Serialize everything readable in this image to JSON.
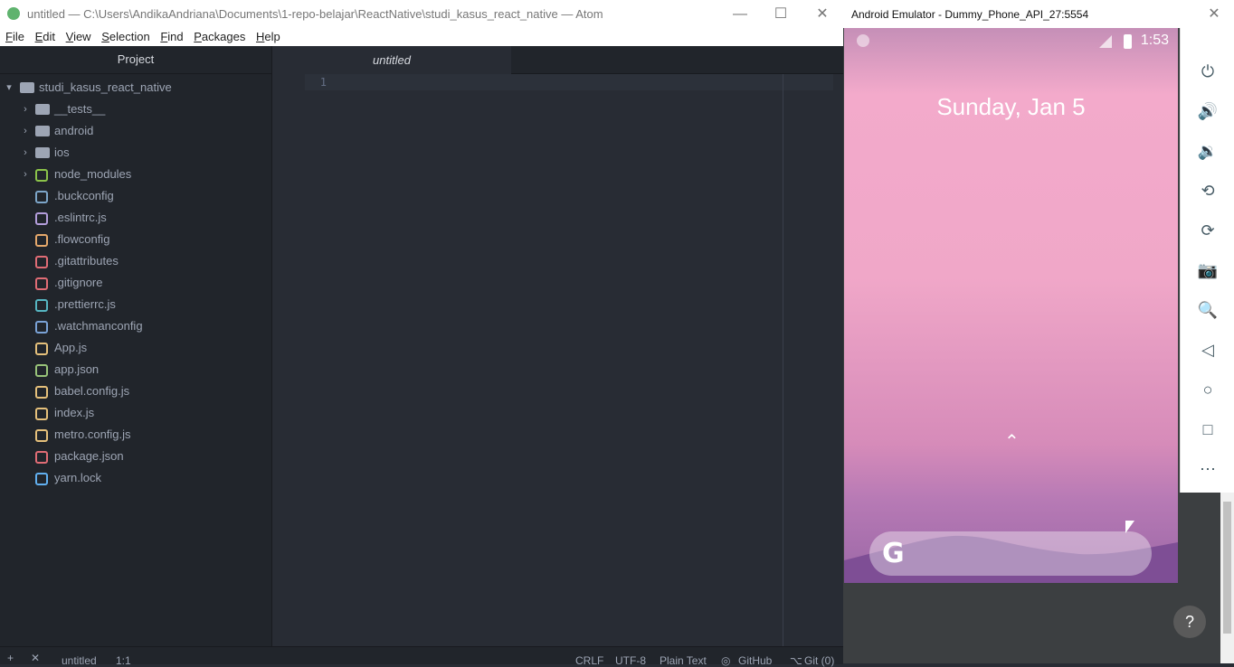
{
  "atom": {
    "window_title": "untitled — C:\\Users\\AndikaAndriana\\Documents\\1-repo-belajar\\ReactNative\\studi_kasus_react_native — Atom",
    "menu": [
      "File",
      "Edit",
      "View",
      "Selection",
      "Find",
      "Packages",
      "Help"
    ],
    "sidebar": {
      "header": "Project",
      "root": "studi_kasus_react_native",
      "items": [
        {
          "label": "__tests__",
          "type": "folder",
          "icon": "folder-icon"
        },
        {
          "label": "android",
          "type": "folder",
          "icon": "folder-icon"
        },
        {
          "label": "ios",
          "type": "folder",
          "icon": "folder-icon"
        },
        {
          "label": "node_modules",
          "type": "folder",
          "icon": "node-modules-icon"
        },
        {
          "label": ".buckconfig",
          "type": "file",
          "icon": "buck-icon"
        },
        {
          "label": ".eslintrc.js",
          "type": "file",
          "icon": "eslint-icon"
        },
        {
          "label": ".flowconfig",
          "type": "file",
          "icon": "flow-icon"
        },
        {
          "label": ".gitattributes",
          "type": "file",
          "icon": "git-icon"
        },
        {
          "label": ".gitignore",
          "type": "file",
          "icon": "git-icon"
        },
        {
          "label": ".prettierrc.js",
          "type": "file",
          "icon": "prettier-icon"
        },
        {
          "label": ".watchmanconfig",
          "type": "file",
          "icon": "watchman-icon"
        },
        {
          "label": "App.js",
          "type": "file",
          "icon": "js-icon"
        },
        {
          "label": "app.json",
          "type": "file",
          "icon": "json-icon"
        },
        {
          "label": "babel.config.js",
          "type": "file",
          "icon": "babel-icon"
        },
        {
          "label": "index.js",
          "type": "file",
          "icon": "js-icon"
        },
        {
          "label": "metro.config.js",
          "type": "file",
          "icon": "js-icon"
        },
        {
          "label": "package.json",
          "type": "file",
          "icon": "npm-icon"
        },
        {
          "label": "yarn.lock",
          "type": "file",
          "icon": "yarn-icon"
        }
      ]
    },
    "editor": {
      "tab_title": "untitled",
      "line_number": "1"
    },
    "statusbar": {
      "file": "untitled",
      "cursor": "1:1",
      "line_ending": "CRLF",
      "encoding": "UTF-8",
      "grammar": "Plain Text",
      "github": "GitHub",
      "git": "Git (0)"
    }
  },
  "emulator": {
    "window_title": "Android Emulator - Dummy_Phone_API_27:5554",
    "status_time": "1:53",
    "date": "Sunday, Jan 5",
    "search_logo": "G",
    "tools": [
      "power-icon",
      "volume-up-icon",
      "volume-down-icon",
      "rotate-left-icon",
      "rotate-right-icon",
      "camera-icon",
      "zoom-icon",
      "back-icon",
      "home-icon",
      "overview-icon",
      "more-icon"
    ]
  },
  "help_label": "?"
}
